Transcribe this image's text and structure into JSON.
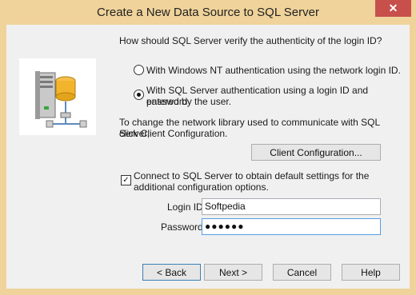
{
  "window": {
    "title": "Create a New Data Source to SQL Server",
    "close_glyph": "✕"
  },
  "question": "How should SQL Server verify the authenticity of the login ID?",
  "auth": {
    "nt_label": "With Windows NT authentication using the network login ID.",
    "sql_label_line1": "With SQL Server authentication using a login ID and password",
    "sql_label_line2": "entered by the user."
  },
  "network": {
    "text_line1": "To change the network library used to communicate with SQL Server,",
    "text_line2": "click Client Configuration.",
    "button_label": "Client Configuration..."
  },
  "connect": {
    "label_line1": "Connect to SQL Server to obtain default settings for the",
    "label_line2": "additional configuration options."
  },
  "login": {
    "label": "Login ID:",
    "value": "Softpedia"
  },
  "password": {
    "label": "Password:",
    "value": "●●●●●●"
  },
  "footer": {
    "back": "< Back",
    "next": "Next >",
    "cancel": "Cancel",
    "help": "Help"
  },
  "colors": {
    "frame": "#f0d39a",
    "close": "#c7504c",
    "client": "#f0f0f0"
  }
}
